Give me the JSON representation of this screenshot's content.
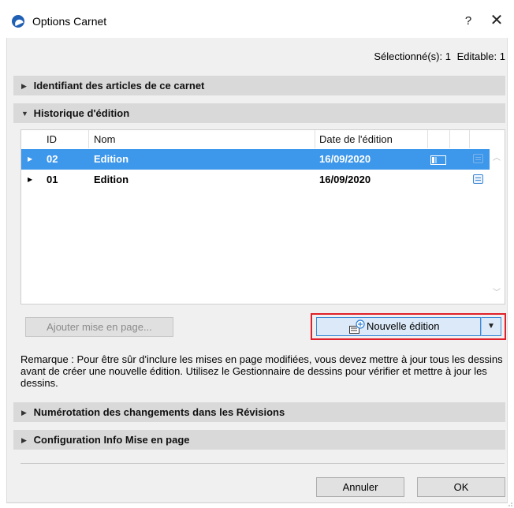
{
  "window": {
    "title": "Options Carnet",
    "help": "?",
    "close": "✕"
  },
  "selection_info": {
    "selected": "Sélectionné(s): 1",
    "editable": "Editable: 1"
  },
  "sections": {
    "identifiant": "Identifiant des articles de ce carnet",
    "historique": "Historique d'édition",
    "numerotation": "Numérotation des changements dans les Révisions",
    "configuration": "Configuration Info Mise en page"
  },
  "table": {
    "columns": [
      "ID",
      "Nom",
      "Date de l'édition"
    ],
    "rows": [
      {
        "id": "02",
        "name": "Edition",
        "date": "16/09/2020",
        "selected": true
      },
      {
        "id": "01",
        "name": "Edition",
        "date": "16/09/2020",
        "selected": false
      }
    ]
  },
  "buttons": {
    "ajouter": "Ajouter mise en page...",
    "nouvelle": "Nouvelle édition",
    "annuler": "Annuler",
    "ok": "OK"
  },
  "remark": "Remarque : Pour être sûr d'inclure les mises en page modifiées, vous devez mettre à jour tous les dessins avant de créer une nouvelle édition. Utilisez le Gestionnaire de dessins pour vérifier et mettre à jour les dessins.",
  "colors": {
    "accent": "#3d97ea",
    "highlight_border": "#e0202a",
    "section_bg": "#d9d9d9"
  },
  "icons": [
    "app-logo-icon",
    "triangle-right-icon",
    "triangle-down-icon",
    "sheet-layout-icon",
    "note-icon",
    "plus-circle-icon",
    "chevron-up-icon",
    "chevron-down-icon"
  ]
}
